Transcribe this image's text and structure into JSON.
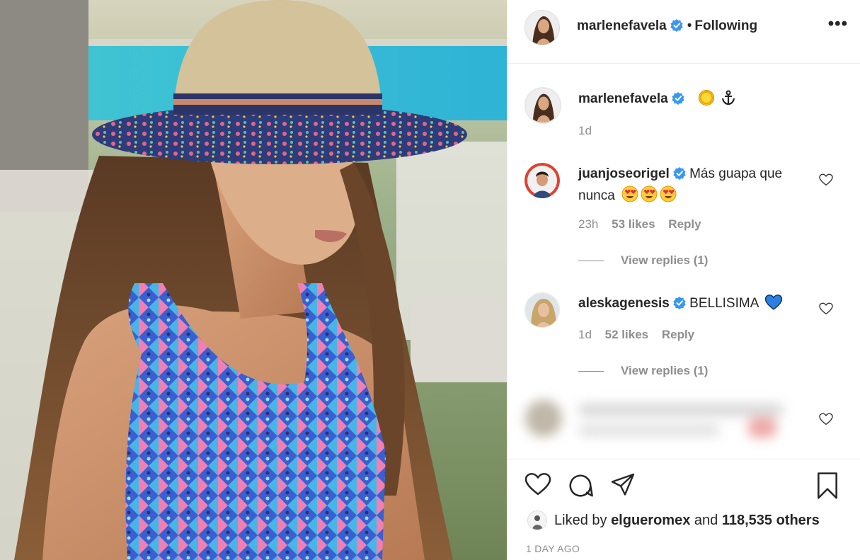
{
  "post": {
    "author": "marlenefavela",
    "follow_sep": "•",
    "follow_status": "Following",
    "more_label": "•••"
  },
  "caption": {
    "author": "marlenefavela",
    "time": "1d"
  },
  "comments": [
    {
      "author": "juanjoseorigel",
      "text": "Más guapa que nunca",
      "time": "23h",
      "likes": "53 likes",
      "reply": "Reply",
      "view_replies": "View replies (1)"
    },
    {
      "author": "aleskagenesis",
      "text": "BELLISIMA",
      "time": "1d",
      "likes": "52 likes",
      "reply": "Reply",
      "view_replies": "View replies (1)"
    }
  ],
  "likes": {
    "prefix": "Liked by",
    "user": "elgueromex",
    "joiner": "and",
    "count": "118,535 others"
  },
  "timestamp": "1 DAY AGO",
  "icons": {
    "verified": "verified-badge-icon",
    "heart": "heart-icon",
    "comment": "comment-icon",
    "share": "share-icon",
    "save": "bookmark-icon"
  },
  "colors": {
    "verified": "#3897f0",
    "text": "#262626",
    "muted": "#8e8e8e",
    "border": "#efefef"
  }
}
